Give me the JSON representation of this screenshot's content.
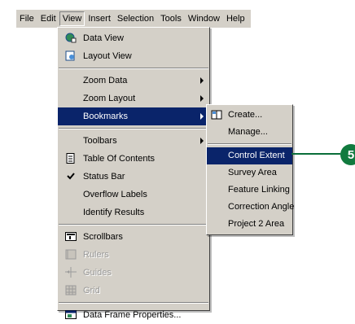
{
  "menubar": {
    "items": [
      "File",
      "Edit",
      "View",
      "Insert",
      "Selection",
      "Tools",
      "Window",
      "Help"
    ]
  },
  "view_menu": {
    "items": {
      "data_view": "Data View",
      "layout_view": "Layout View",
      "zoom_data": "Zoom Data",
      "zoom_layout": "Zoom Layout",
      "bookmarks": "Bookmarks",
      "toolbars": "Toolbars",
      "table_of_contents": "Table Of Contents",
      "status_bar": "Status Bar",
      "overflow_labels": "Overflow Labels",
      "identify_results": "Identify Results",
      "scrollbars": "Scrollbars",
      "rulers": "Rulers",
      "guides": "Guides",
      "grid": "Grid",
      "data_frame_properties": "Data Frame Properties..."
    }
  },
  "bookmarks_menu": {
    "items": [
      "Create...",
      "Manage...",
      "Control Extent",
      "Survey Area",
      "Feature Linking",
      "Correction Angle",
      "Project 2 Area"
    ]
  },
  "callout": {
    "number": "5",
    "color": "#117a3e"
  },
  "colors": {
    "menu_bg": "#d4d0c8",
    "highlight": "#0a246a"
  }
}
